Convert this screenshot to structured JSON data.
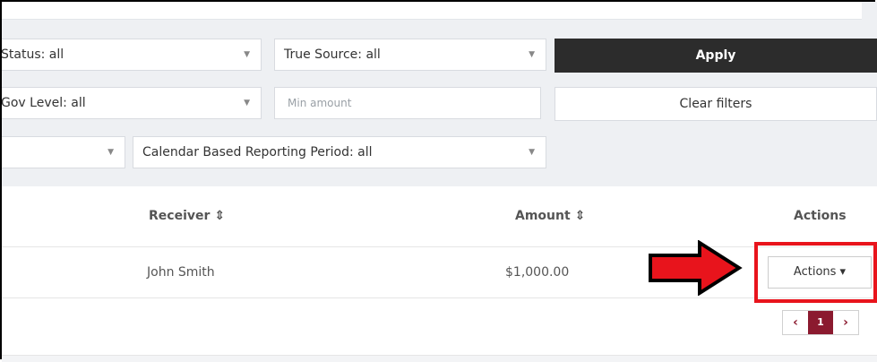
{
  "filters": {
    "status": "Status: all",
    "true_source": "True Source: all",
    "gov_level": "Gov Level: all",
    "min_amount_placeholder": "Min amount",
    "reporting_period": "Calendar Based Reporting Period: all",
    "apply_label": "Apply",
    "clear_label": "Clear filters"
  },
  "table": {
    "headers": {
      "receiver": "Receiver ⇕",
      "amount": "Amount ⇕",
      "actions": "Actions"
    },
    "rows": [
      {
        "receiver": "John Smith",
        "amount": "$1,000.00",
        "actions_label": "Actions ▾"
      }
    ]
  },
  "pagination": {
    "prev": "‹",
    "current": "1",
    "next": "›"
  },
  "colors": {
    "highlight": "#e8141c",
    "arrow": "#e8141c",
    "pager_accent": "#8b1a2f",
    "apply_bg": "#2c2c2c"
  }
}
